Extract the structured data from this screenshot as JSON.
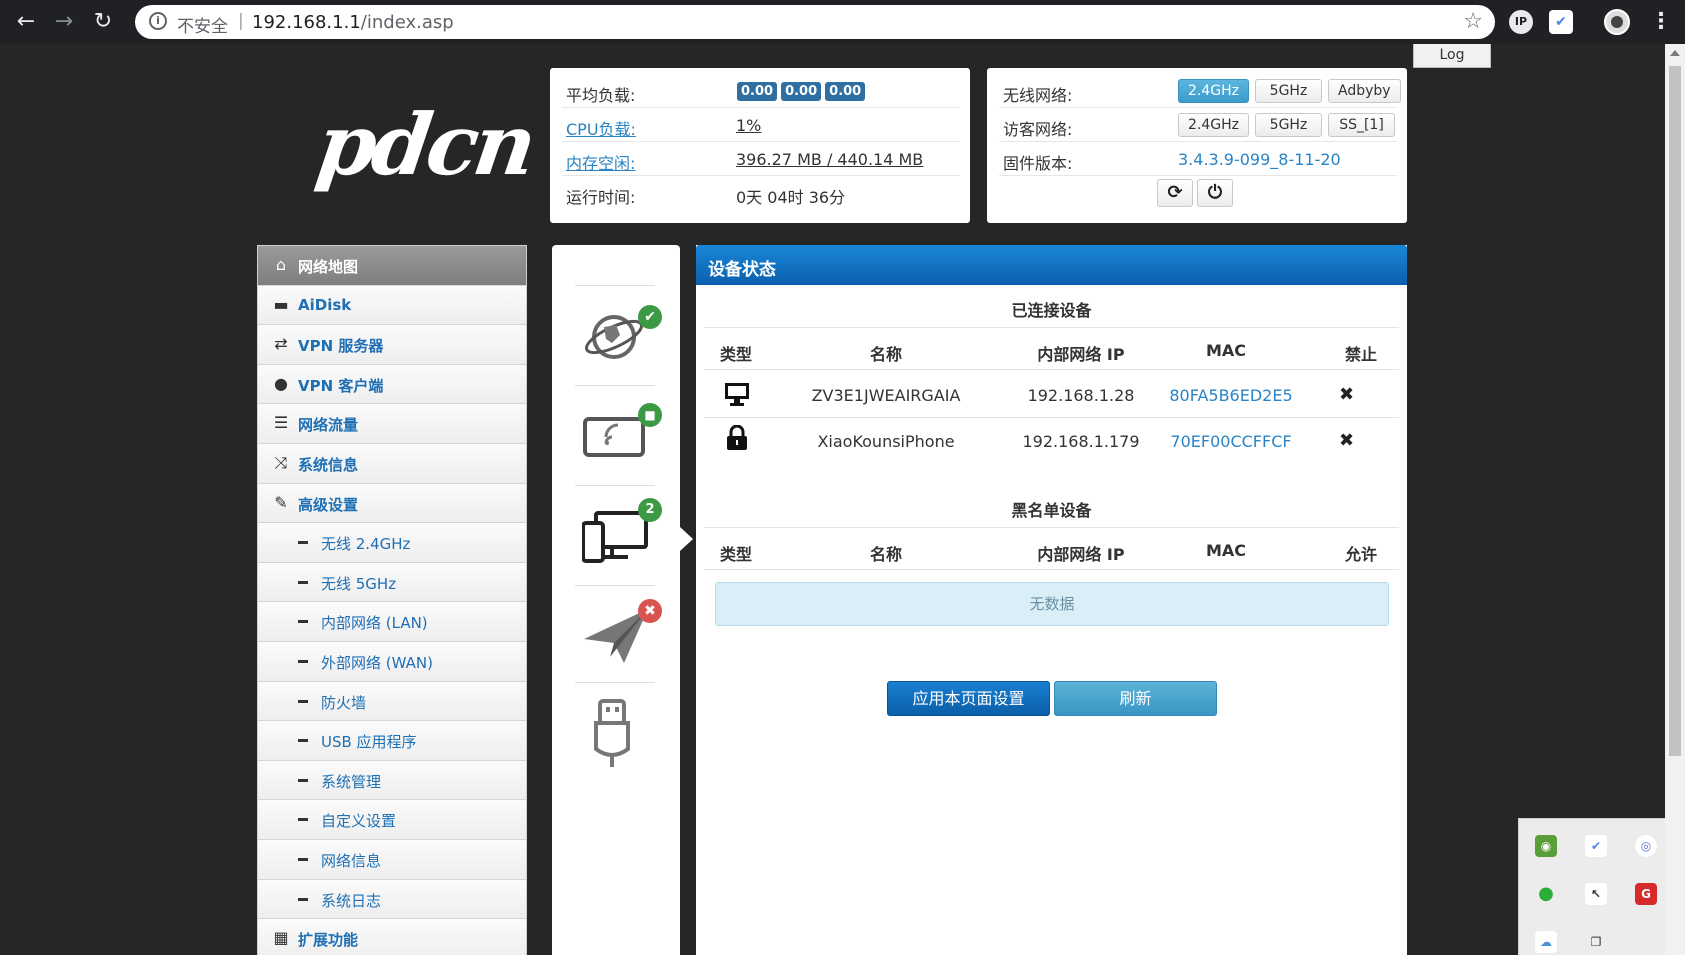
{
  "browser": {
    "insecure_label": "不安全",
    "separator": "|",
    "url_host": "192.168.1.1",
    "url_path": "/index.asp",
    "ext_ip_label": "IP"
  },
  "log_tab": "Log",
  "logo_text": "pdcn",
  "status": {
    "avg_load_label": "平均负载:",
    "load": [
      "0.00",
      "0.00",
      "0.00"
    ],
    "cpu_label": "CPU负载:",
    "cpu_value": "1%",
    "mem_label": "内存空闲:",
    "mem_value": "396.27 MB / 440.14 MB",
    "uptime_label": "运行时间:",
    "uptime_value": "0天 04时 36分"
  },
  "wifi": {
    "wireless_label": "无线网络:",
    "wireless_buttons": [
      "2.4GHz",
      "5GHz",
      "Adbyby"
    ],
    "guest_label": "访客网络:",
    "guest_buttons": [
      "2.4GHz",
      "5GHz",
      "SS_[1]"
    ],
    "firmware_label": "固件版本:",
    "firmware_value": "3.4.3.9-099_8-11-20"
  },
  "sidebar": {
    "items": [
      {
        "label": "网络地图",
        "icon": "home-icon"
      },
      {
        "label": "AiDisk",
        "icon": "disk-icon"
      },
      {
        "label": "VPN 服务器",
        "icon": "retweet-icon"
      },
      {
        "label": "VPN 客户端",
        "icon": "globe-icon"
      },
      {
        "label": "网络流量",
        "icon": "list-icon"
      },
      {
        "label": "系统信息",
        "icon": "shuffle-icon"
      },
      {
        "label": "高级设置",
        "icon": "wrench-icon"
      },
      {
        "label": "无线 2.4GHz"
      },
      {
        "label": "无线 5GHz"
      },
      {
        "label": "内部网络 (LAN)"
      },
      {
        "label": "外部网络 (WAN)"
      },
      {
        "label": "防火墙"
      },
      {
        "label": "USB 应用程序"
      },
      {
        "label": "系统管理"
      },
      {
        "label": "自定义设置"
      },
      {
        "label": "网络信息"
      },
      {
        "label": "系统日志"
      },
      {
        "label": "扩展功能",
        "icon": "grid-icon"
      }
    ]
  },
  "icon_column": {
    "clients_count": "2"
  },
  "main": {
    "title": "设备状态",
    "connected_title": "已连接设备",
    "connected_headers": [
      "类型",
      "名称",
      "内部网络 IP",
      "MAC",
      "禁止"
    ],
    "connected_rows": [
      {
        "type_icon": "desktop-icon",
        "name": "ZV3E1JWEAIRGAIA",
        "ip": "192.168.1.28",
        "mac": "80FA5B6ED2E5"
      },
      {
        "type_icon": "lock-icon",
        "name": "XiaoKounsiPhone",
        "ip": "192.168.1.179",
        "mac": "70EF00CCFFCF"
      }
    ],
    "blacklist_title": "黑名单设备",
    "blacklist_headers": [
      "类型",
      "名称",
      "内部网络 IP",
      "MAC",
      "允许"
    ],
    "empty_text": "无数据",
    "apply_button": "应用本页面设置",
    "refresh_button": "刷新"
  },
  "colors": {
    "accent_blue": "#0c5fae",
    "link_blue": "#2a83c5",
    "active_toggle": "#3a9ccc",
    "ok_green": "#3d9a44",
    "error_red": "#d9534f"
  }
}
